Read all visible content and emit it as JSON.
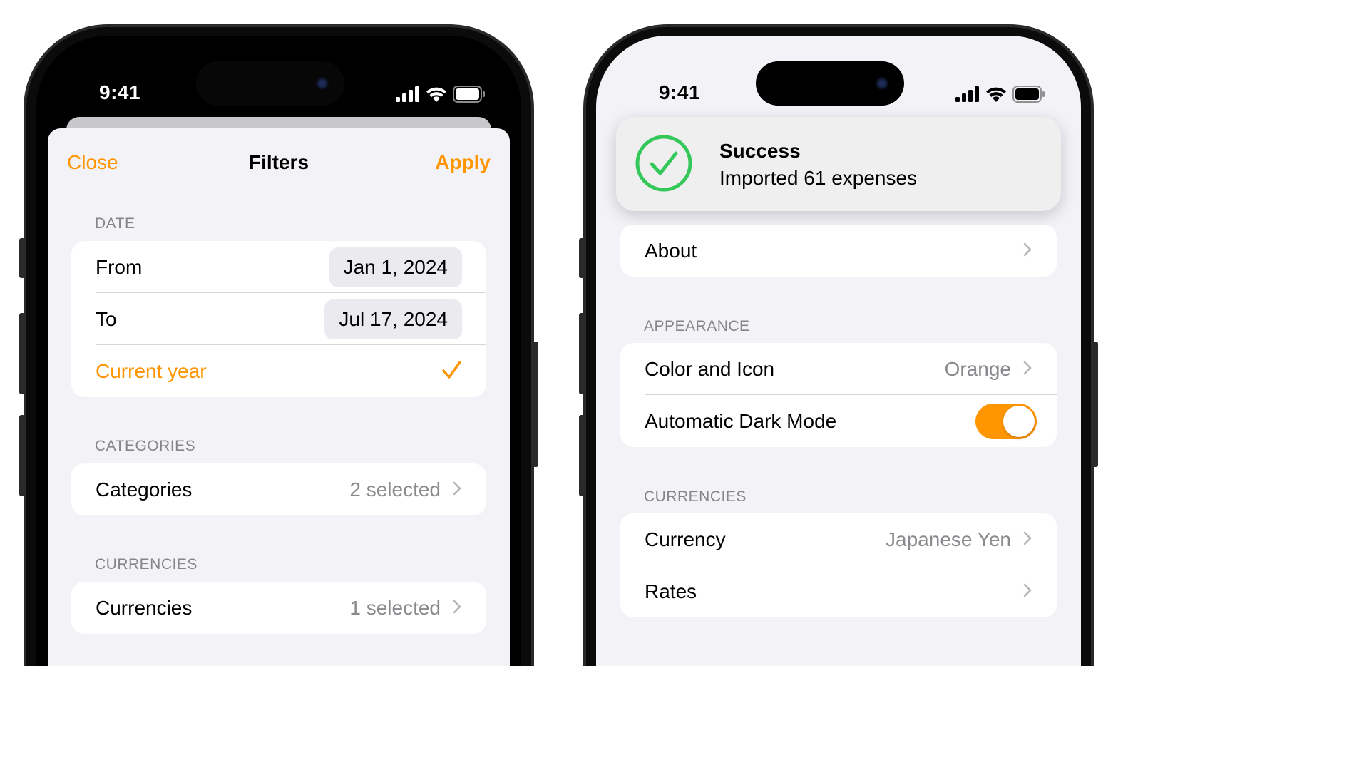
{
  "filters_screen": {
    "status": {
      "time": "9:41"
    },
    "nav": {
      "close_label": "Close",
      "title": "Filters",
      "apply_label": "Apply"
    },
    "date_section": {
      "header": "DATE",
      "from_label": "From",
      "from_value": "Jan 1, 2024",
      "to_label": "To",
      "to_value": "Jul 17, 2024",
      "current_year_label": "Current year",
      "current_year_checked": true
    },
    "categories_section": {
      "header": "CATEGORIES",
      "label": "Categories",
      "value": "2 selected"
    },
    "currencies_section": {
      "header": "CURRENCIES",
      "label": "Currencies",
      "value": "1 selected"
    }
  },
  "settings_screen": {
    "status": {
      "time": "9:41"
    },
    "toast": {
      "title": "Success",
      "message": "Imported 61 expenses"
    },
    "about_row": {
      "label": "About"
    },
    "appearance_section": {
      "header": "APPEARANCE",
      "color_label": "Color and Icon",
      "color_value": "Orange",
      "dark_mode_label": "Automatic Dark Mode",
      "dark_mode_enabled": true
    },
    "currencies_section": {
      "header": "CURRENCIES",
      "currency_label": "Currency",
      "currency_value": "Japanese Yen",
      "rates_label": "Rates"
    }
  },
  "colors": {
    "accent": "#ff9500",
    "success": "#34c759",
    "grouped_background": "#f2f2f7",
    "secondary_text": "#8a8a8e"
  },
  "icons": [
    "signal-icon",
    "wifi-icon",
    "battery-icon",
    "chevron-right-icon",
    "checkmark-icon",
    "success-check-icon"
  ]
}
